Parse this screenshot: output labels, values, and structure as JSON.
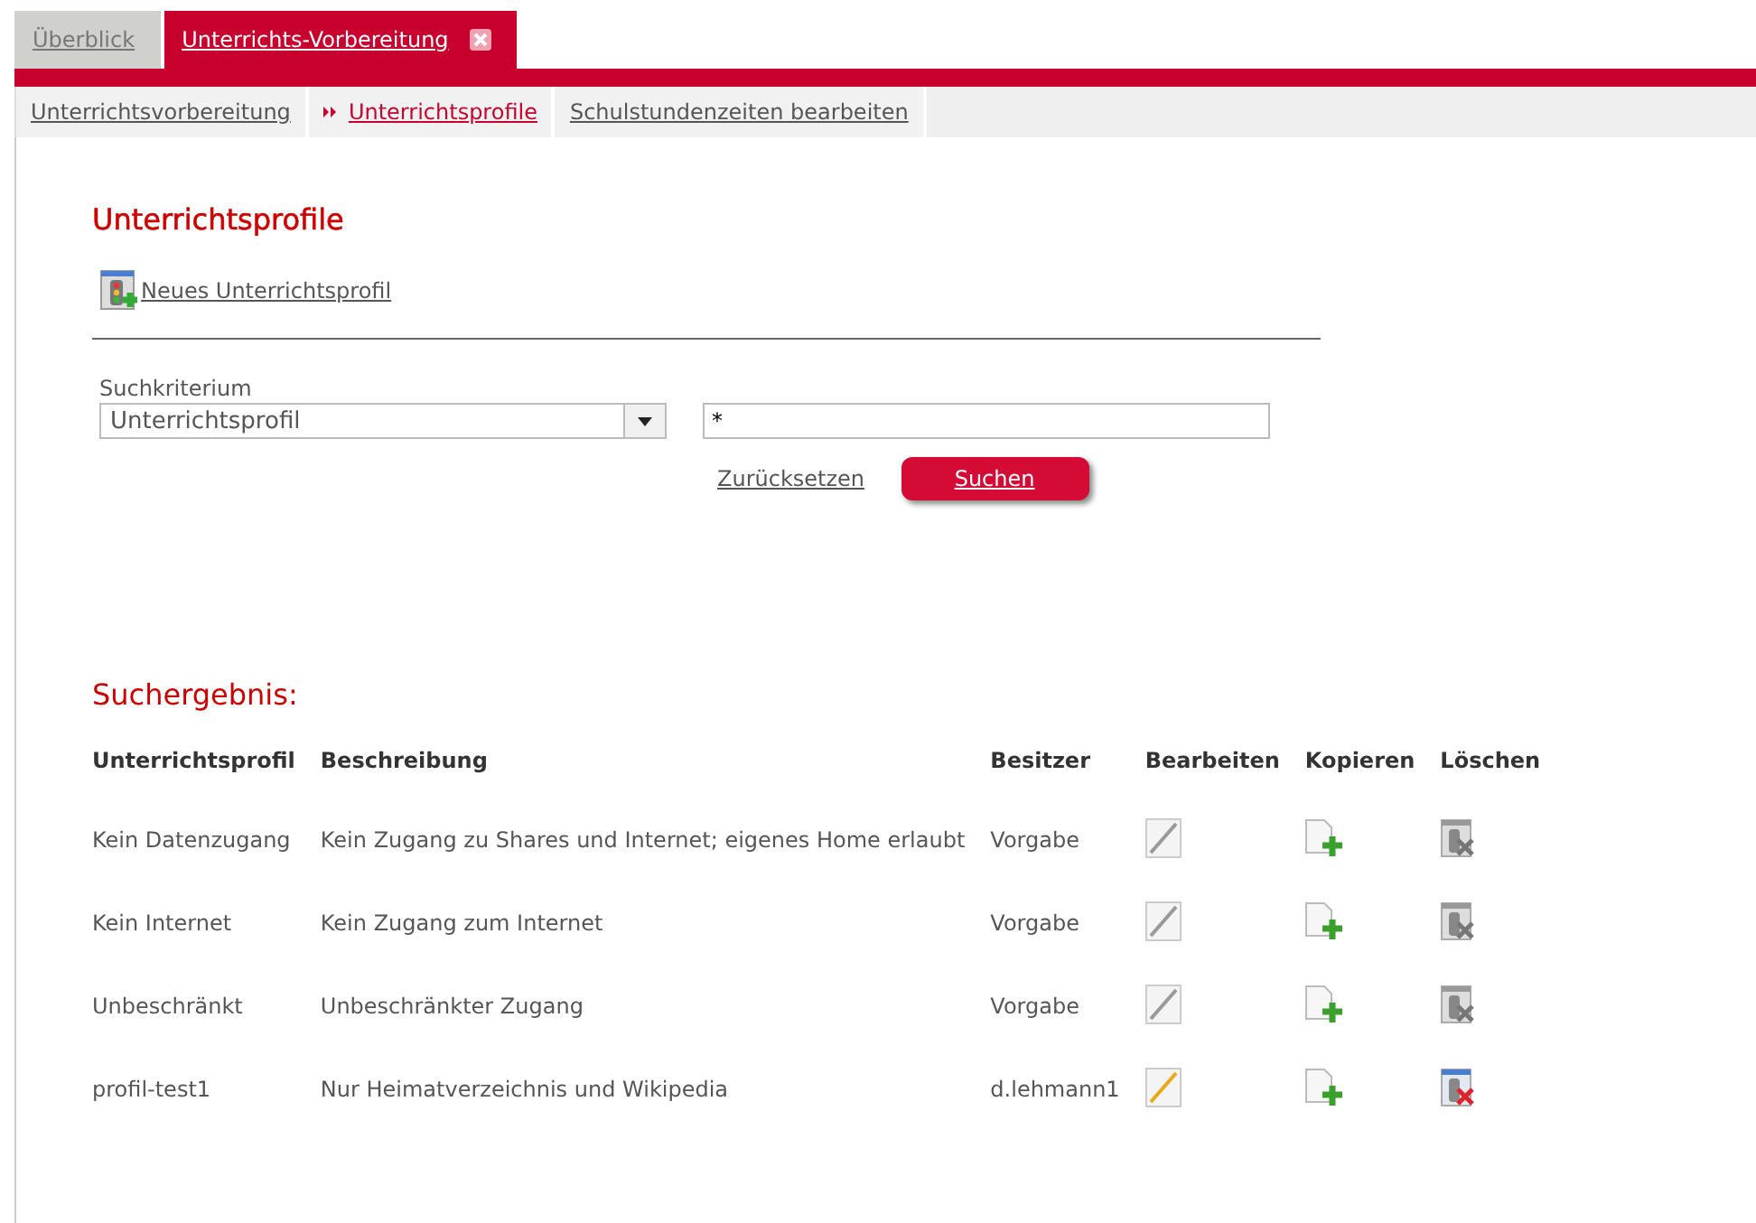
{
  "tabs": [
    {
      "label": "Überblick",
      "selected": false,
      "closable": false
    },
    {
      "label": "Unterrichts-Vorbereitung",
      "selected": true,
      "closable": true
    }
  ],
  "subnav": [
    {
      "label": "Unterrichtsvorbereitung",
      "selected": false
    },
    {
      "label": "Unterrichtsprofile",
      "selected": true
    },
    {
      "label": "Schulstundenzeiten bearbeiten",
      "selected": false
    }
  ],
  "heading": "Unterrichtsprofile",
  "new_link": "Neues Unterrichtsprofil",
  "search": {
    "label": "Suchkriterium",
    "criterion": "Unterrichtsprofil",
    "value": "*",
    "reset": "Zurücksetzen",
    "submit": "Suchen"
  },
  "results": {
    "title": "Suchergebnis:",
    "columns": [
      "Unterrichtsprofil",
      "Beschreibung",
      "Besitzer",
      "Bearbeiten",
      "Kopieren",
      "Löschen"
    ],
    "rows": [
      {
        "name": "Kein Datenzugang",
        "description": "Kein Zugang zu Shares und Internet; eigenes Home erlaubt",
        "owner": "Vorgabe",
        "editable": false
      },
      {
        "name": "Kein Internet",
        "description": "Kein Zugang zum Internet",
        "owner": "Vorgabe",
        "editable": false
      },
      {
        "name": "Unbeschränkt",
        "description": "Unbeschränkter Zugang",
        "owner": "Vorgabe",
        "editable": false
      },
      {
        "name": "profil-test1",
        "description": "Nur Heimatverzeichnis und Wikipedia",
        "owner": "d.lehmann1",
        "editable": true
      }
    ]
  }
}
